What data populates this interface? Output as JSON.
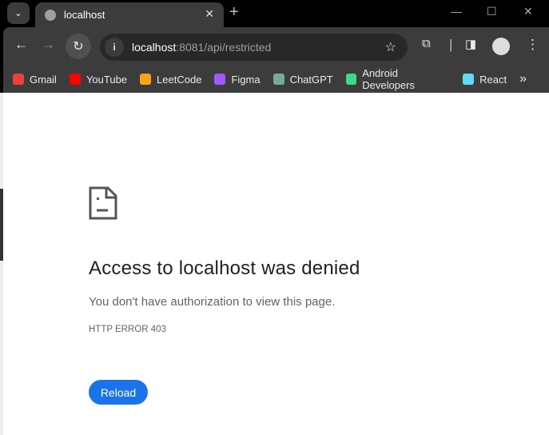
{
  "tab": {
    "title": "localhost",
    "icon": "globe-icon"
  },
  "address": {
    "host": "localhost",
    "rest": ":8081/api/restricted"
  },
  "bookmarks": [
    {
      "label": "Gmail",
      "color": "#ea4335"
    },
    {
      "label": "YouTube",
      "color": "#ff0000"
    },
    {
      "label": "LeetCode",
      "color": "#ffa116"
    },
    {
      "label": "Figma",
      "color": "#a259ff"
    },
    {
      "label": "ChatGPT",
      "color": "#74aa9c"
    },
    {
      "label": "Android Developers",
      "color": "#3ddc84"
    },
    {
      "label": "React",
      "color": "#61dafb"
    }
  ],
  "error": {
    "title": "Access to localhost was denied",
    "description": "You don't have authorization to view this page.",
    "code": "HTTP ERROR 403",
    "reload_label": "Reload",
    "accent": "#1a73e8"
  }
}
